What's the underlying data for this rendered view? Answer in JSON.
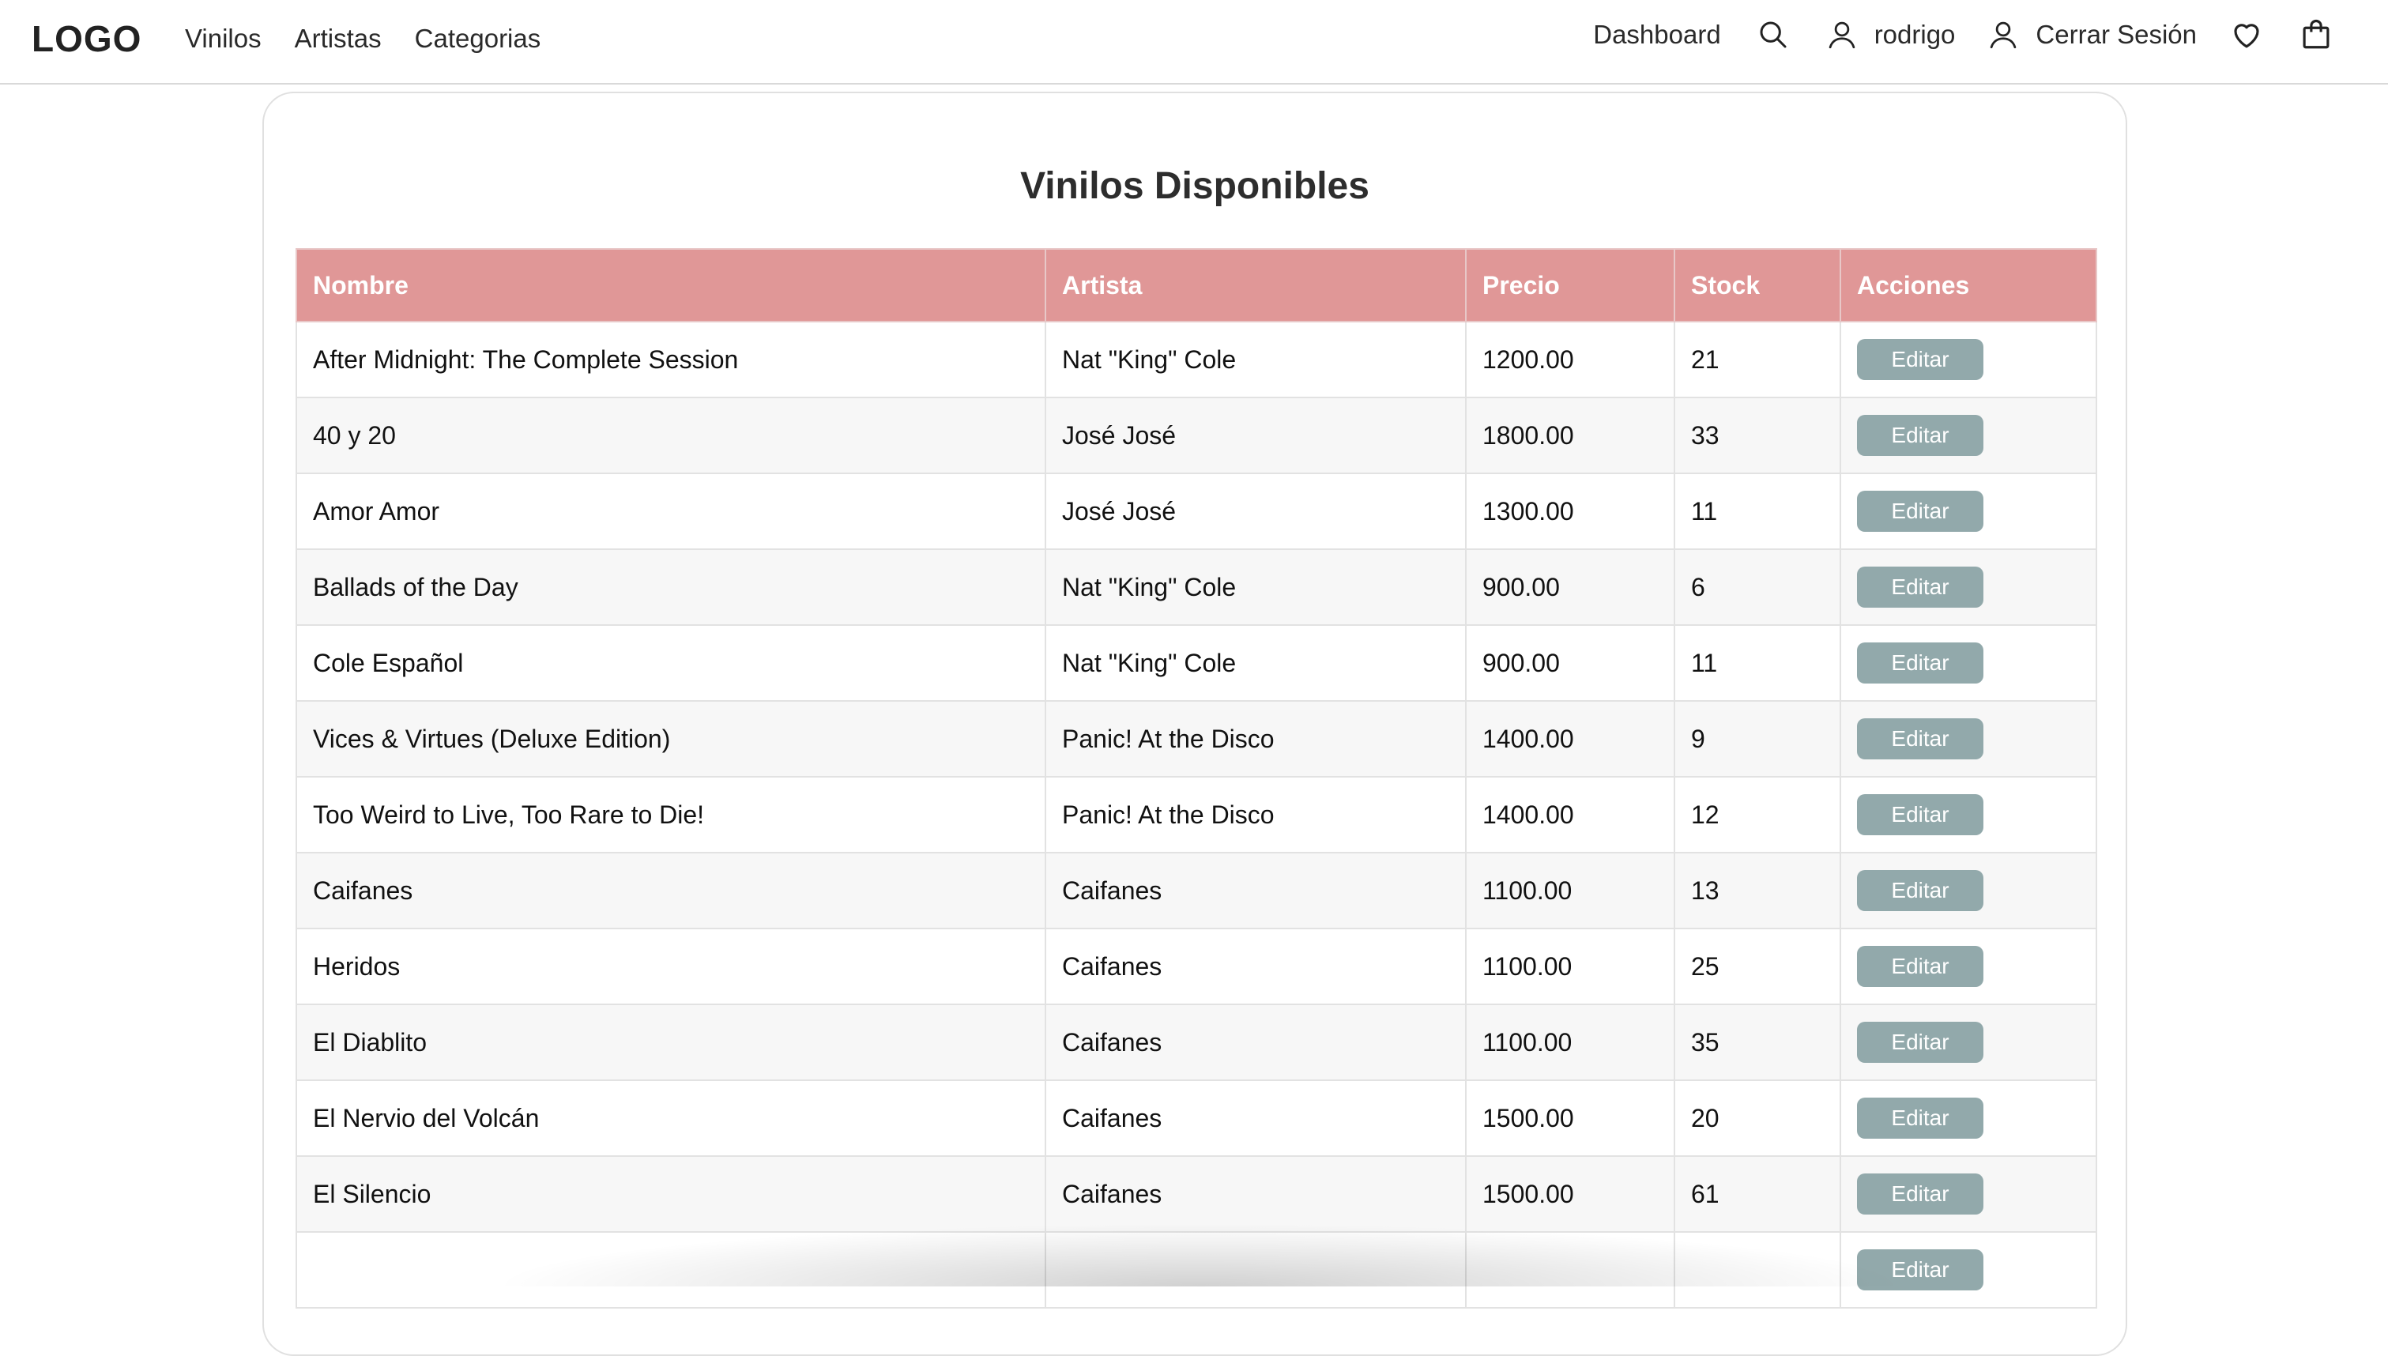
{
  "nav": {
    "logo": "LOGO",
    "links": [
      {
        "label": "Vinilos"
      },
      {
        "label": "Artistas"
      },
      {
        "label": "Categorias"
      }
    ],
    "dashboard": "Dashboard",
    "username": "rodrigo",
    "logout": "Cerrar Sesión",
    "icons": [
      "search-icon",
      "user-icon",
      "user-icon",
      "heart-icon",
      "shopping-bag-icon"
    ]
  },
  "page": {
    "title": "Vinilos Disponibles"
  },
  "table": {
    "headers": [
      "Nombre",
      "Artista",
      "Precio",
      "Stock",
      "Acciones"
    ],
    "edit_label": "Editar",
    "rows": [
      {
        "nombre": "After Midnight: The Complete Session",
        "artista": "Nat \"King\" Cole",
        "precio": "1200.00",
        "stock": "21"
      },
      {
        "nombre": "40 y 20",
        "artista": "José José",
        "precio": "1800.00",
        "stock": "33"
      },
      {
        "nombre": "Amor Amor",
        "artista": "José José",
        "precio": "1300.00",
        "stock": "11"
      },
      {
        "nombre": "Ballads of the Day",
        "artista": "Nat \"King\" Cole",
        "precio": "900.00",
        "stock": "6"
      },
      {
        "nombre": "Cole Español",
        "artista": "Nat \"King\" Cole",
        "precio": "900.00",
        "stock": "11"
      },
      {
        "nombre": "Vices & Virtues (Deluxe Edition)",
        "artista": "Panic! At the Disco",
        "precio": "1400.00",
        "stock": "9"
      },
      {
        "nombre": "Too Weird to Live, Too Rare to Die!",
        "artista": "Panic! At the Disco",
        "precio": "1400.00",
        "stock": "12"
      },
      {
        "nombre": "Caifanes",
        "artista": "Caifanes",
        "precio": "1100.00",
        "stock": "13"
      },
      {
        "nombre": "Heridos",
        "artista": "Caifanes",
        "precio": "1100.00",
        "stock": "25"
      },
      {
        "nombre": "El Diablito",
        "artista": "Caifanes",
        "precio": "1100.00",
        "stock": "35"
      },
      {
        "nombre": "El Nervio del Volcán",
        "artista": "Caifanes",
        "precio": "1500.00",
        "stock": "20"
      },
      {
        "nombre": "El Silencio",
        "artista": "Caifanes",
        "precio": "1500.00",
        "stock": "61"
      },
      {
        "nombre": "",
        "artista": "",
        "precio": "",
        "stock": ""
      }
    ]
  },
  "colors": {
    "header_bg": "#e09797",
    "edit_button": "#92a9ab"
  }
}
